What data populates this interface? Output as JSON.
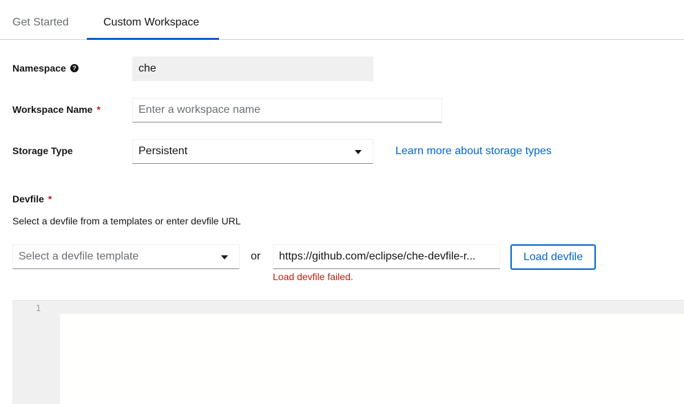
{
  "tabs": [
    {
      "label": "Get Started"
    },
    {
      "label": "Custom Workspace"
    }
  ],
  "form": {
    "namespace": {
      "label": "Namespace",
      "value": "che"
    },
    "workspace_name": {
      "label": "Workspace Name",
      "required": "*",
      "placeholder": "Enter a workspace name"
    },
    "storage_type": {
      "label": "Storage Type",
      "value": "Persistent",
      "learn_more": "Learn more about storage types"
    },
    "devfile": {
      "label": "Devfile",
      "required": "*",
      "help": "Select a devfile from a templates or enter devfile URL",
      "template_placeholder": "Select a devfile template",
      "or": "or",
      "url_value": "https://github.com/eclipse/che-devfile-r...",
      "load_button": "Load devfile",
      "error": "Load devfile failed."
    }
  },
  "editor": {
    "line_numbers": [
      "1"
    ]
  },
  "colors": {
    "accent": "#0066cc",
    "error": "#c9190b"
  }
}
